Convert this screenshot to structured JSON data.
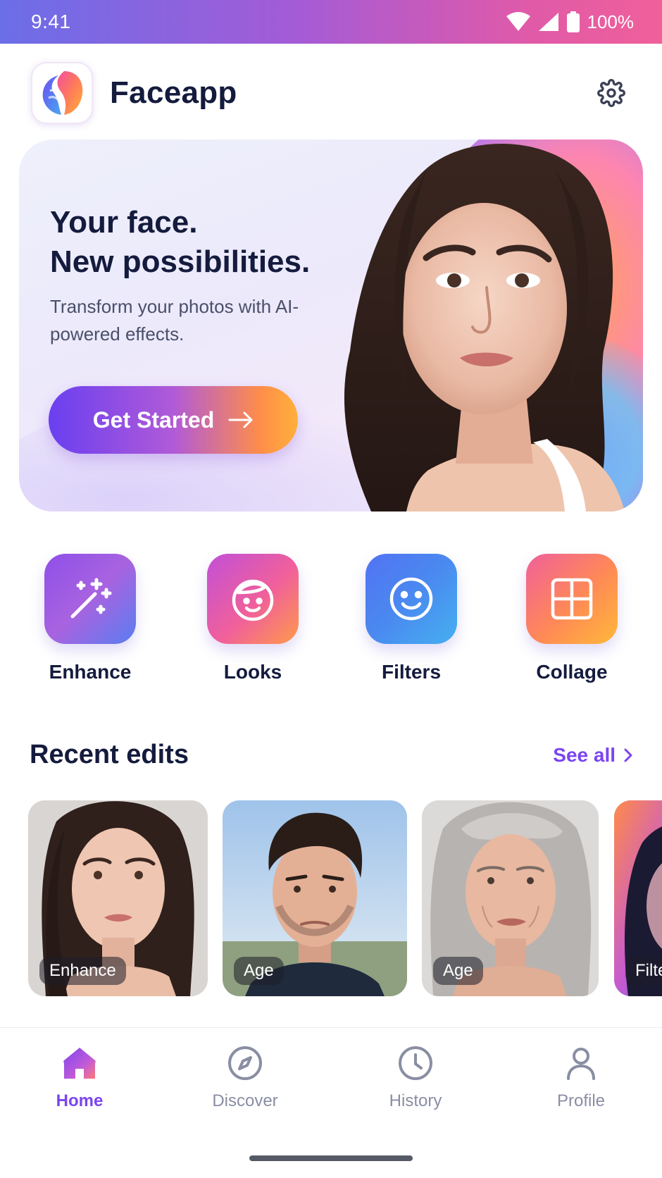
{
  "status_bar": {
    "time": "9:41",
    "battery": "100%"
  },
  "header": {
    "title": "Faceapp",
    "logo_icon": "faceapp-logo-icon",
    "settings_icon": "gear-icon"
  },
  "hero": {
    "title_line1": "Your face.",
    "title_line2": "New possibilities.",
    "subtitle": "Transform your photos with AI-powered effects.",
    "cta_label": "Get Started",
    "cta_icon": "arrow-right-icon"
  },
  "tools": [
    {
      "label": "Enhance",
      "icon": "magic-wand-icon"
    },
    {
      "label": "Looks",
      "icon": "face-icon"
    },
    {
      "label": "Filters",
      "icon": "smiley-icon"
    },
    {
      "label": "Collage",
      "icon": "grid-icon"
    }
  ],
  "recent": {
    "title": "Recent edits",
    "see_all": "See all",
    "items": [
      {
        "badge": "Enhance"
      },
      {
        "badge": "Age"
      },
      {
        "badge": "Age"
      },
      {
        "badge": "Filte"
      }
    ]
  },
  "nav": {
    "items": [
      {
        "label": "Home",
        "icon": "home-icon",
        "active": true
      },
      {
        "label": "Discover",
        "icon": "compass-icon",
        "active": false
      },
      {
        "label": "History",
        "icon": "clock-icon",
        "active": false
      },
      {
        "label": "Profile",
        "icon": "person-icon",
        "active": false
      }
    ]
  },
  "colors": {
    "accent": "#7b45f0",
    "text": "#141b3d",
    "muted": "#8a8ea3"
  }
}
